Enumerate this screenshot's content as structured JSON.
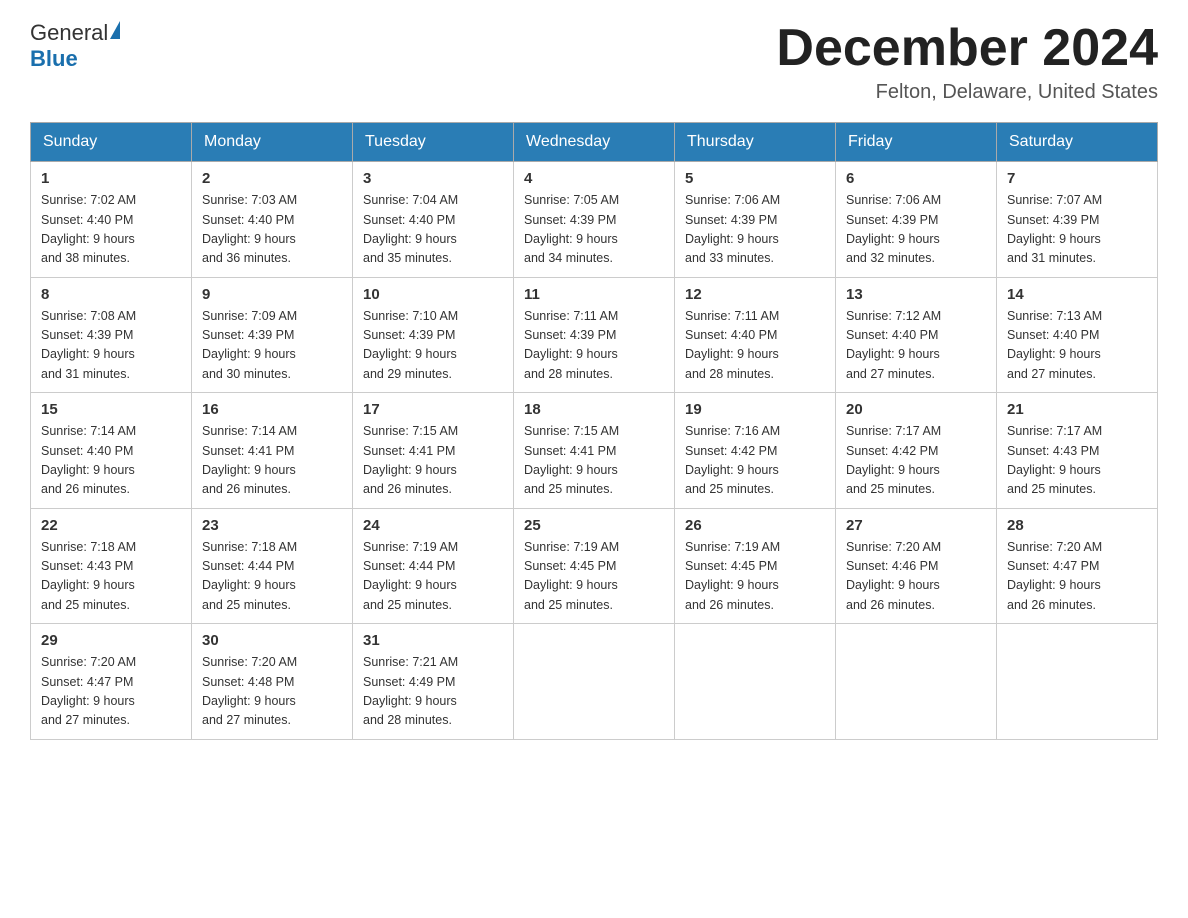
{
  "header": {
    "logo_general": "General",
    "logo_blue": "Blue",
    "title": "December 2024",
    "subtitle": "Felton, Delaware, United States"
  },
  "weekdays": [
    "Sunday",
    "Monday",
    "Tuesday",
    "Wednesday",
    "Thursday",
    "Friday",
    "Saturday"
  ],
  "weeks": [
    [
      {
        "day": "1",
        "sunrise": "7:02 AM",
        "sunset": "4:40 PM",
        "daylight": "9 hours and 38 minutes."
      },
      {
        "day": "2",
        "sunrise": "7:03 AM",
        "sunset": "4:40 PM",
        "daylight": "9 hours and 36 minutes."
      },
      {
        "day": "3",
        "sunrise": "7:04 AM",
        "sunset": "4:40 PM",
        "daylight": "9 hours and 35 minutes."
      },
      {
        "day": "4",
        "sunrise": "7:05 AM",
        "sunset": "4:39 PM",
        "daylight": "9 hours and 34 minutes."
      },
      {
        "day": "5",
        "sunrise": "7:06 AM",
        "sunset": "4:39 PM",
        "daylight": "9 hours and 33 minutes."
      },
      {
        "day": "6",
        "sunrise": "7:06 AM",
        "sunset": "4:39 PM",
        "daylight": "9 hours and 32 minutes."
      },
      {
        "day": "7",
        "sunrise": "7:07 AM",
        "sunset": "4:39 PM",
        "daylight": "9 hours and 31 minutes."
      }
    ],
    [
      {
        "day": "8",
        "sunrise": "7:08 AM",
        "sunset": "4:39 PM",
        "daylight": "9 hours and 31 minutes."
      },
      {
        "day": "9",
        "sunrise": "7:09 AM",
        "sunset": "4:39 PM",
        "daylight": "9 hours and 30 minutes."
      },
      {
        "day": "10",
        "sunrise": "7:10 AM",
        "sunset": "4:39 PM",
        "daylight": "9 hours and 29 minutes."
      },
      {
        "day": "11",
        "sunrise": "7:11 AM",
        "sunset": "4:39 PM",
        "daylight": "9 hours and 28 minutes."
      },
      {
        "day": "12",
        "sunrise": "7:11 AM",
        "sunset": "4:40 PM",
        "daylight": "9 hours and 28 minutes."
      },
      {
        "day": "13",
        "sunrise": "7:12 AM",
        "sunset": "4:40 PM",
        "daylight": "9 hours and 27 minutes."
      },
      {
        "day": "14",
        "sunrise": "7:13 AM",
        "sunset": "4:40 PM",
        "daylight": "9 hours and 27 minutes."
      }
    ],
    [
      {
        "day": "15",
        "sunrise": "7:14 AM",
        "sunset": "4:40 PM",
        "daylight": "9 hours and 26 minutes."
      },
      {
        "day": "16",
        "sunrise": "7:14 AM",
        "sunset": "4:41 PM",
        "daylight": "9 hours and 26 minutes."
      },
      {
        "day": "17",
        "sunrise": "7:15 AM",
        "sunset": "4:41 PM",
        "daylight": "9 hours and 26 minutes."
      },
      {
        "day": "18",
        "sunrise": "7:15 AM",
        "sunset": "4:41 PM",
        "daylight": "9 hours and 25 minutes."
      },
      {
        "day": "19",
        "sunrise": "7:16 AM",
        "sunset": "4:42 PM",
        "daylight": "9 hours and 25 minutes."
      },
      {
        "day": "20",
        "sunrise": "7:17 AM",
        "sunset": "4:42 PM",
        "daylight": "9 hours and 25 minutes."
      },
      {
        "day": "21",
        "sunrise": "7:17 AM",
        "sunset": "4:43 PM",
        "daylight": "9 hours and 25 minutes."
      }
    ],
    [
      {
        "day": "22",
        "sunrise": "7:18 AM",
        "sunset": "4:43 PM",
        "daylight": "9 hours and 25 minutes."
      },
      {
        "day": "23",
        "sunrise": "7:18 AM",
        "sunset": "4:44 PM",
        "daylight": "9 hours and 25 minutes."
      },
      {
        "day": "24",
        "sunrise": "7:19 AM",
        "sunset": "4:44 PM",
        "daylight": "9 hours and 25 minutes."
      },
      {
        "day": "25",
        "sunrise": "7:19 AM",
        "sunset": "4:45 PM",
        "daylight": "9 hours and 25 minutes."
      },
      {
        "day": "26",
        "sunrise": "7:19 AM",
        "sunset": "4:45 PM",
        "daylight": "9 hours and 26 minutes."
      },
      {
        "day": "27",
        "sunrise": "7:20 AM",
        "sunset": "4:46 PM",
        "daylight": "9 hours and 26 minutes."
      },
      {
        "day": "28",
        "sunrise": "7:20 AM",
        "sunset": "4:47 PM",
        "daylight": "9 hours and 26 minutes."
      }
    ],
    [
      {
        "day": "29",
        "sunrise": "7:20 AM",
        "sunset": "4:47 PM",
        "daylight": "9 hours and 27 minutes."
      },
      {
        "day": "30",
        "sunrise": "7:20 AM",
        "sunset": "4:48 PM",
        "daylight": "9 hours and 27 minutes."
      },
      {
        "day": "31",
        "sunrise": "7:21 AM",
        "sunset": "4:49 PM",
        "daylight": "9 hours and 28 minutes."
      },
      null,
      null,
      null,
      null
    ]
  ],
  "labels": {
    "sunrise": "Sunrise:",
    "sunset": "Sunset:",
    "daylight": "Daylight:"
  }
}
